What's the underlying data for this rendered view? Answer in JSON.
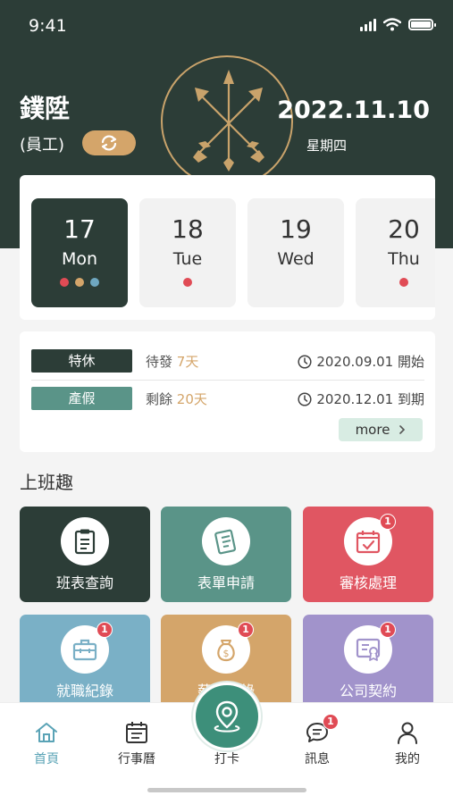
{
  "status_bar": {
    "time": "9:41"
  },
  "header": {
    "user_name": "鏷陞",
    "role": "(員工)",
    "date": "2022.11.10",
    "weekday": "星期四",
    "accent_color": "#2c3d37",
    "gold_color": "#d4a56a"
  },
  "week": {
    "days": [
      {
        "num": "17",
        "label": "Mon",
        "active": true,
        "dots": [
          "#e04b55",
          "#d4a56a",
          "#6fa7c0"
        ]
      },
      {
        "num": "18",
        "label": "Tue",
        "active": false,
        "dots": [
          "#e04b55"
        ]
      },
      {
        "num": "19",
        "label": "Wed",
        "active": false,
        "dots": []
      },
      {
        "num": "20",
        "label": "Thu",
        "active": false,
        "dots": [
          "#e04b55"
        ]
      }
    ]
  },
  "leave": {
    "rows": [
      {
        "tag": "特休",
        "tag_color": "#2c3d37",
        "status_prefix": "待發",
        "status_value": "7天",
        "date": "2020.09.01 開始"
      },
      {
        "tag": "產假",
        "tag_color": "#5a9488",
        "status_prefix": "剩餘",
        "status_value": "20天",
        "date": "2020.12.01 到期"
      }
    ],
    "more_label": "more"
  },
  "section_title": "上班趣",
  "tiles": [
    {
      "label": "班表查詢",
      "color": "#2c3d37",
      "icon": "clipboard-icon",
      "badge": ""
    },
    {
      "label": "表單申請",
      "color": "#5a9488",
      "icon": "form-icon",
      "badge": ""
    },
    {
      "label": "審核處理",
      "color": "#e05662",
      "icon": "calendar-check-icon",
      "badge": "1"
    },
    {
      "label": "就職紀錄",
      "color": "#7ab0c6",
      "icon": "briefcase-icon",
      "badge": "1"
    },
    {
      "label": "薪資紀錄",
      "color": "#d4a56a",
      "icon": "money-bag-icon",
      "badge": "1"
    },
    {
      "label": "公司契約",
      "color": "#a193cb",
      "icon": "certificate-icon",
      "badge": "1"
    }
  ],
  "tabbar": {
    "home": "首頁",
    "calendar": "行事曆",
    "punch": "打卡",
    "messages": "訊息",
    "messages_badge": "1",
    "profile": "我的"
  }
}
